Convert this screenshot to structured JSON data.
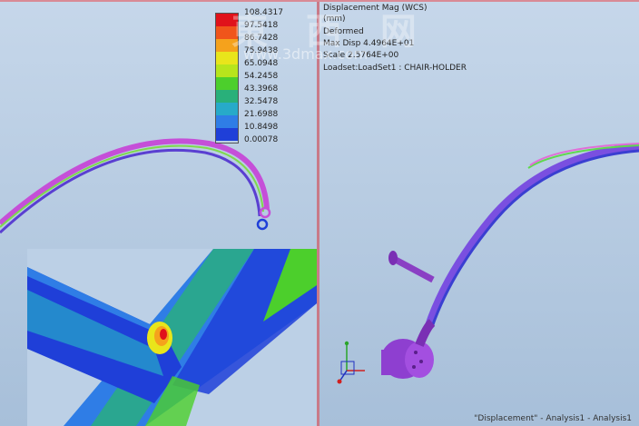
{
  "legend": {
    "labels": [
      "108.4317",
      "97.5418",
      "86.7428",
      "75.9438",
      "65.0948",
      "54.2458",
      "43.3968",
      "32.5478",
      "21.6988",
      "10.8498",
      "0.00078"
    ],
    "colors": [
      "#e0121b",
      "#f0551b",
      "#f5a21c",
      "#e9e51b",
      "#b7e51c",
      "#4ccf2c",
      "#29b07a",
      "#27aac9",
      "#2f7de6",
      "#1f3fd8"
    ]
  },
  "info": {
    "line1": "Displacement Mag (WCS)",
    "line2": "(mm)",
    "line3": "Deformed",
    "line4": "Max Disp 4.4964E+01",
    "line5": "Scale 2.5764E+00",
    "line6": "Loadset:LoadSet1 :  CHAIR-HOLDER"
  },
  "footer": "\"Displacement\" - Analysis1 - Analysis1",
  "watermark": {
    "text": "東 西 网",
    "url": "www.3dmax.com"
  },
  "colors": {
    "background": "#b4c9df",
    "divider": "#c97a88"
  }
}
